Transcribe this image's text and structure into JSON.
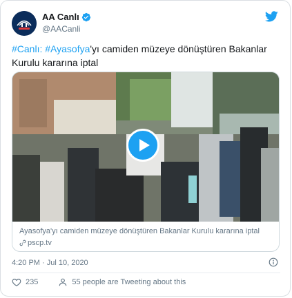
{
  "tweet": {
    "author_name": "AA Canlı",
    "handle": "@AACanli",
    "text_parts": {
      "tag1": "#Canlı:",
      "space": " ",
      "tag2": "#Ayasofya",
      "rest": "'yı camiden müzeye dönüştüren Bakanlar Kurulu kararına iptal"
    },
    "time": "4:20 PM · Jul 10, 2020",
    "likes": "235",
    "people_tweeting": "55 people are Tweeting about this"
  },
  "card": {
    "title": "Ayasofya'yı camiden müzeye dönüştüren Bakanlar Kurulu kararına iptal",
    "domain": "pscp.tv"
  },
  "icons": {
    "avatar": "aa-logo-avatar",
    "verified": "verified-badge-icon",
    "brand": "twitter-bird-icon",
    "play": "play-icon",
    "link": "link-icon",
    "info": "info-icon",
    "like": "heart-icon",
    "people": "person-icon"
  },
  "colors": {
    "accent": "#1da1f2",
    "text": "#14171a",
    "muted": "#657786"
  }
}
